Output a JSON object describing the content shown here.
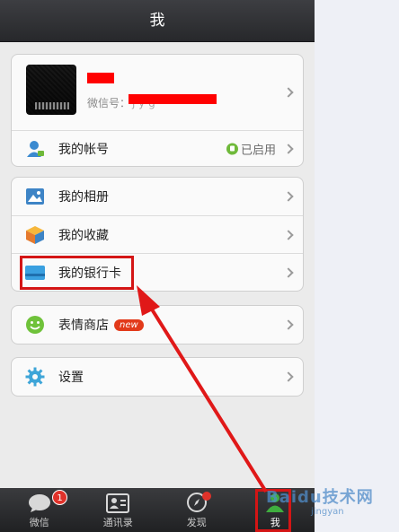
{
  "header": {
    "title": "我"
  },
  "profile": {
    "wechat_id_label": "微信号：",
    "wechat_id_fragment": "j y g"
  },
  "account": {
    "label": "我的帐号",
    "status": "已启用"
  },
  "menu1": [
    {
      "label": "我的相册",
      "icon": "photo-album-icon"
    },
    {
      "label": "我的收藏",
      "icon": "favorites-box-icon"
    },
    {
      "label": "我的银行卡",
      "icon": "bank-card-icon"
    }
  ],
  "sticker_store": {
    "label": "表情商店",
    "badge": "new",
    "icon": "smiley-icon"
  },
  "settings": {
    "label": "设置",
    "icon": "gear-icon"
  },
  "tabs": [
    {
      "label": "微信",
      "icon": "chat-bubble-icon",
      "badge": "1"
    },
    {
      "label": "通讯录",
      "icon": "contacts-icon"
    },
    {
      "label": "发现",
      "icon": "compass-icon"
    },
    {
      "label": "我",
      "icon": "person-icon",
      "active": true
    }
  ],
  "watermark": {
    "text": "Baidu技术网",
    "sub": "jingyan"
  },
  "colors": {
    "annotation_red": "#d41515",
    "enabled_green": "#6fb93a",
    "tabbar_bg": "#27282b"
  }
}
